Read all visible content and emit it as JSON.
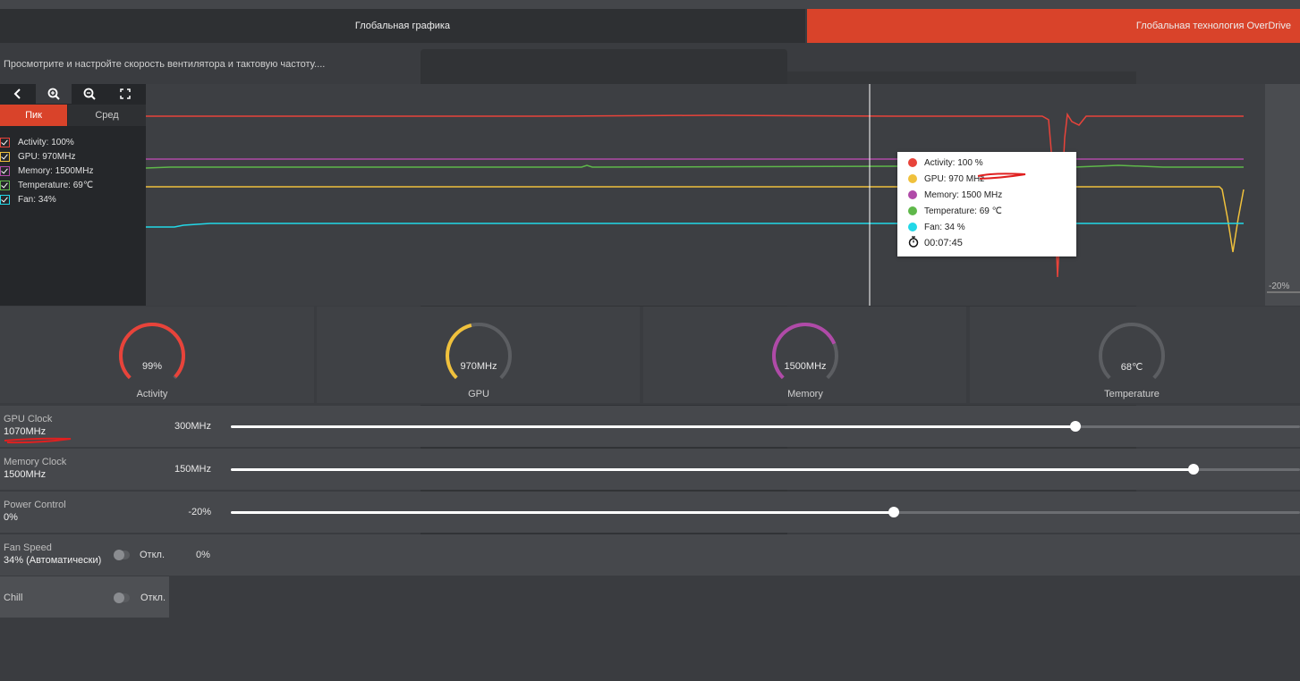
{
  "tabs": {
    "global_graphics": "Глобальная графика",
    "overdrive": "Глобальная технология OverDrive"
  },
  "subtitle": "Просмотрите и настройте скорость вентилятора и тактовую частоту....",
  "chart_controls": {
    "mode_peak": "Пик",
    "mode_avg": "Сред",
    "tools": [
      "back-icon",
      "zoom-in-icon",
      "zoom-out-icon",
      "reset-zoom-icon"
    ]
  },
  "legend": [
    {
      "label": "Activity: 100%",
      "color": "#e8433a"
    },
    {
      "label": "GPU: 970MHz",
      "color": "#f0c13c"
    },
    {
      "label": "Memory: 1500MHz",
      "color": "#b04aa8"
    },
    {
      "label": "Temperature: 69℃",
      "color": "#5fb84a"
    },
    {
      "label": "Fan: 34%",
      "color": "#22d8e8"
    }
  ],
  "right_axis_label": "-20%",
  "tooltip": {
    "activity": "Activity: 100 %",
    "gpu": "GPU: 970 MHz",
    "memory": "Memory: 1500 MHz",
    "temperature": "Temperature: 69 ℃",
    "fan": "Fan: 34 %",
    "time": "00:07:45",
    "colors": {
      "activity": "#e8433a",
      "gpu": "#f0c13c",
      "memory": "#b04aa8",
      "temperature": "#5fb84a",
      "fan": "#22d8e8"
    }
  },
  "gauges": [
    {
      "value": "99%",
      "label": "Activity",
      "fraction": 0.99,
      "color": "#e8433a"
    },
    {
      "value": "970MHz",
      "label": "GPU",
      "fraction": 0.45,
      "color": "#f0c13c"
    },
    {
      "value": "1500MHz",
      "label": "Memory",
      "fraction": 0.75,
      "color": "#b04aa8"
    },
    {
      "value": "68℃",
      "label": "Temperature",
      "fraction": 0.0,
      "color": "#6a6c70"
    }
  ],
  "controls": {
    "gpu_clock": {
      "label": "GPU Clock",
      "value": "1070MHz",
      "min": "300MHz",
      "fraction": 0.79
    },
    "memory_clock": {
      "label": "Memory Clock",
      "value": "1500MHz",
      "min": "150MHz",
      "fraction": 0.9
    },
    "power_control": {
      "label": "Power Control",
      "value": "0%",
      "min": "-20%",
      "fraction": 0.62
    },
    "fan_speed": {
      "label": "Fan Speed",
      "value": "34% (Автоматически)",
      "toggle": "Откл.",
      "percent": "0%"
    },
    "chill": {
      "label": "Chill",
      "toggle": "Откл."
    }
  }
}
